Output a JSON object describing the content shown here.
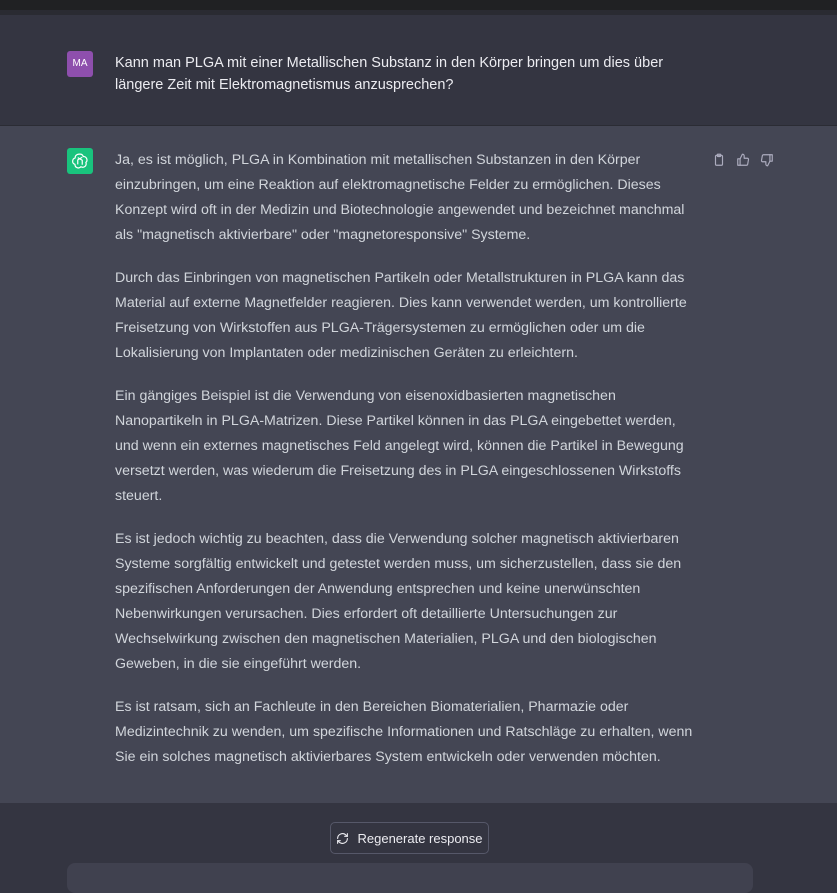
{
  "conversation": {
    "user": {
      "avatar_initials": "MA",
      "message": "Kann man PLGA mit einer Metallischen Substanz in den Körper bringen um dies über längere Zeit mit Elektromagnetismus anzusprechen?"
    },
    "assistant": {
      "avatar_icon": "openai-logo-icon",
      "paragraphs": [
        "Ja, es ist möglich, PLGA in Kombination mit metallischen Substanzen in den Körper einzubringen, um eine Reaktion auf elektromagnetische Felder zu ermöglichen. Dieses Konzept wird oft in der Medizin und Biotechnologie angewendet und bezeichnet manchmal als \"magnetisch aktivierbare\" oder \"magnetoresponsive\" Systeme.",
        "Durch das Einbringen von magnetischen Partikeln oder Metallstrukturen in PLGA kann das Material auf externe Magnetfelder reagieren. Dies kann verwendet werden, um kontrollierte Freisetzung von Wirkstoffen aus PLGA-Trägersystemen zu ermöglichen oder um die Lokalisierung von Implantaten oder medizinischen Geräten zu erleichtern.",
        "Ein gängiges Beispiel ist die Verwendung von eisenoxidbasierten magnetischen Nanopartikeln in PLGA-Matrizen. Diese Partikel können in das PLGA eingebettet werden, und wenn ein externes magnetisches Feld angelegt wird, können die Partikel in Bewegung versetzt werden, was wiederum die Freisetzung des in PLGA eingeschlossenen Wirkstoffs steuert.",
        "Es ist jedoch wichtig zu beachten, dass die Verwendung solcher magnetisch aktivierbaren Systeme sorgfältig entwickelt und getestet werden muss, um sicherzustellen, dass sie den spezifischen Anforderungen der Anwendung entsprechen und keine unerwünschten Nebenwirkungen verursachen. Dies erfordert oft detaillierte Untersuchungen zur Wechselwirkung zwischen den magnetischen Materialien, PLGA und den biologischen Geweben, in die sie eingeführt werden.",
        "Es ist ratsam, sich an Fachleute in den Bereichen Biomaterialien, Pharmazie oder Medizintechnik zu wenden, um spezifische Informationen und Ratschläge zu erhalten, wenn Sie ein solches magnetisch aktivierbares System entwickeln oder verwenden möchten."
      ],
      "actions": [
        "clipboard-icon",
        "thumbs-up-icon",
        "thumbs-down-icon"
      ]
    }
  },
  "footer": {
    "regenerate_label": "Regenerate response",
    "regenerate_icon": "refresh-icon"
  },
  "colors": {
    "background": "#343541",
    "assistant_background": "#444654",
    "user_avatar": "#8e4fad",
    "assistant_avatar": "#19c37d"
  }
}
